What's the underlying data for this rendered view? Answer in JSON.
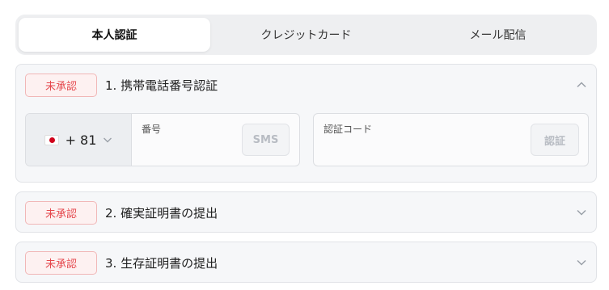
{
  "tabs": [
    {
      "label": "本人認証",
      "active": true
    },
    {
      "label": "クレジットカード",
      "active": false
    },
    {
      "label": "メール配信",
      "active": false
    }
  ],
  "sections": [
    {
      "badge": "未承認",
      "title": "1. 携帯電話番号認証",
      "expanded": true
    },
    {
      "badge": "未承認",
      "title": "2. 確実証明書の提出",
      "expanded": false
    },
    {
      "badge": "未承認",
      "title": "3. 生存証明書の提出",
      "expanded": false
    }
  ],
  "phone": {
    "country_code": "+ 81",
    "number_label": "番号",
    "number_value": "",
    "sms_button": "SMS"
  },
  "verification": {
    "code_label": "認証コード",
    "code_value": "",
    "verify_button": "認証"
  },
  "colors": {
    "badge_text": "#e5484d",
    "badge_border": "#f1b7b7",
    "tab_bg": "#eeeff1",
    "section_bg": "#f6f7f9"
  },
  "icons": {
    "collapse": "chevron-up-icon",
    "expand": "chevron-down-icon",
    "country_dropdown": "chevron-down-icon",
    "flag": "japan-flag-icon"
  }
}
